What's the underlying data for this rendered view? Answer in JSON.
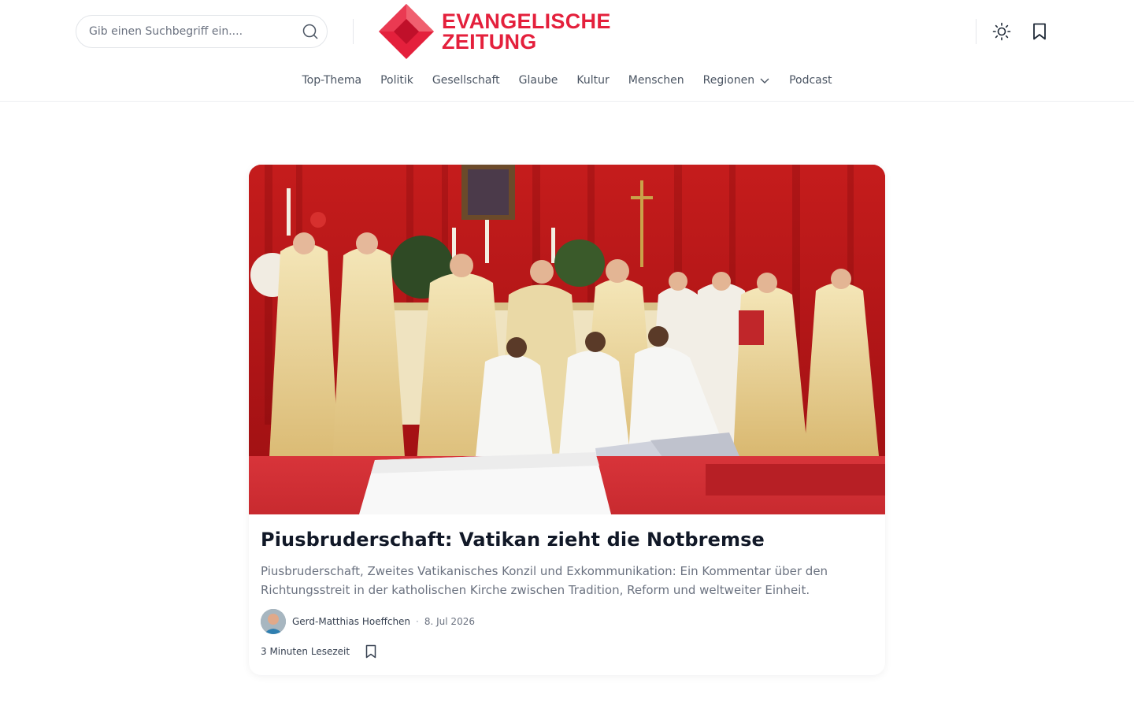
{
  "brand": {
    "name_line1": "EVANGELISCHE",
    "name_line2": "ZEITUNG",
    "color": "#e4203c"
  },
  "header": {
    "search": {
      "placeholder": "Gib einen Suchbegriff ein...."
    },
    "icons": {
      "theme": "sun-icon",
      "bookmarks": "bookmark-icon",
      "search": "search-icon"
    }
  },
  "nav": {
    "items": [
      {
        "label": "Top-Thema"
      },
      {
        "label": "Politik"
      },
      {
        "label": "Gesellschaft"
      },
      {
        "label": "Glaube"
      },
      {
        "label": "Kultur"
      },
      {
        "label": "Menschen"
      },
      {
        "label": "Regionen",
        "icon": "chevron-down-icon"
      },
      {
        "label": "Podcast"
      }
    ]
  },
  "article": {
    "title": "Piusbruderschaft: Vatikan zieht die Notbremse",
    "excerpt": "Piusbruderschaft, Zweites Vatikanisches Konzil und Exkommunikation: Ein Kommentar über den Richtungsstreit in der katholischen Kirche zwischen Tradition, Reform und weltweiter Einheit.",
    "author": "Gerd-Matthias Hoeffchen",
    "separator": "·",
    "date": "8. Jul 2026",
    "read_time": "3 Minuten Lesezeit",
    "image": "ordination-ceremony-photo"
  }
}
